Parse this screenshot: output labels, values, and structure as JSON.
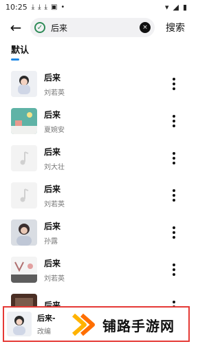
{
  "status": {
    "time": "10:25",
    "left_icons": [
      "download-icon",
      "download-icon",
      "download-icon",
      "photo-icon",
      "dot-icon"
    ],
    "right_icons": [
      "wifi-icon",
      "signal-icon",
      "battery-icon"
    ]
  },
  "search": {
    "query": "后来",
    "back_icon": "arrow-left-icon",
    "clear_icon": "close-circle-icon",
    "search_label": "搜索"
  },
  "tabs": {
    "active_label": "默认",
    "accent": "#1e88e5"
  },
  "results": [
    {
      "title": "后来",
      "artist": "刘若英",
      "thumb": "portrait-light"
    },
    {
      "title": "后来",
      "artist": "夏婉安",
      "thumb": "scene-teal"
    },
    {
      "title": "后来",
      "artist": "刘大壮",
      "thumb": "placeholder"
    },
    {
      "title": "后来",
      "artist": "刘若英",
      "thumb": "placeholder"
    },
    {
      "title": "后来",
      "artist": "孙露",
      "thumb": "portrait-dark"
    },
    {
      "title": "后来",
      "artist": "刘若英",
      "thumb": "scene-light"
    },
    {
      "title": "后来",
      "artist": "",
      "thumb": "scene-brown"
    }
  ],
  "mini_player": {
    "title": "后来-",
    "artist": "改编",
    "border_color": "#e53935"
  },
  "watermark": {
    "text": "铺路手游网"
  }
}
